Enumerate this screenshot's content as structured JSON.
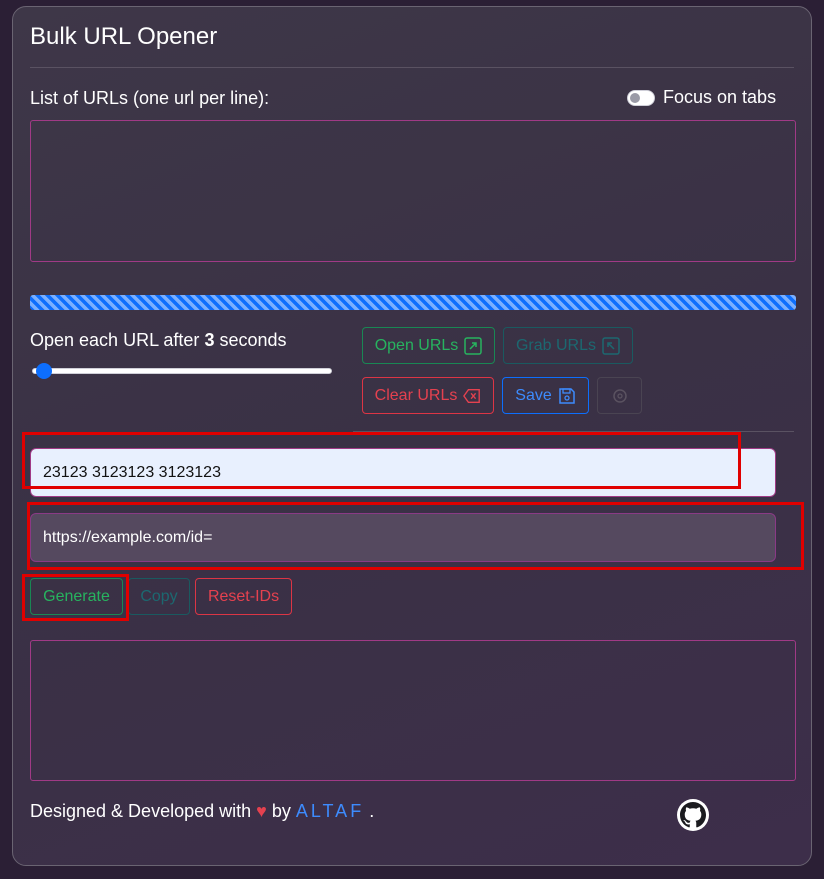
{
  "app": {
    "title": "Bulk URL Opener"
  },
  "urls": {
    "label": "List of URLs (one url per line):",
    "value": "",
    "focus_toggle": {
      "label": "Focus on tabs",
      "checked": false
    }
  },
  "progress": {
    "fraction": 1.0
  },
  "timer": {
    "prefix": "Open each URL after ",
    "seconds": "3",
    "suffix": " seconds"
  },
  "actions": {
    "open_label": "Open URLs",
    "grab_label": "Grab URLs",
    "clear_label": "Clear URLs",
    "save_label": "Save"
  },
  "generator": {
    "ids_value": "23123 3123123 3123123",
    "base_url_value": "https://example.com/id=",
    "generate_label": "Generate",
    "copy_label": "Copy",
    "reset_label": "Reset-IDs",
    "output_value": ""
  },
  "footer": {
    "prefix": "Designed & Developed with ",
    "heart": "♥",
    "by": " by ",
    "author": "ALTAF",
    "end": " ."
  },
  "colors": {
    "accent_blue": "#0d6efd",
    "green": "#198754",
    "red": "#dc3545",
    "highlight": "#e00000"
  },
  "icons": [
    "open-external-icon",
    "grab-icon",
    "clear-icon",
    "save-icon",
    "settings-icon",
    "github-icon"
  ]
}
